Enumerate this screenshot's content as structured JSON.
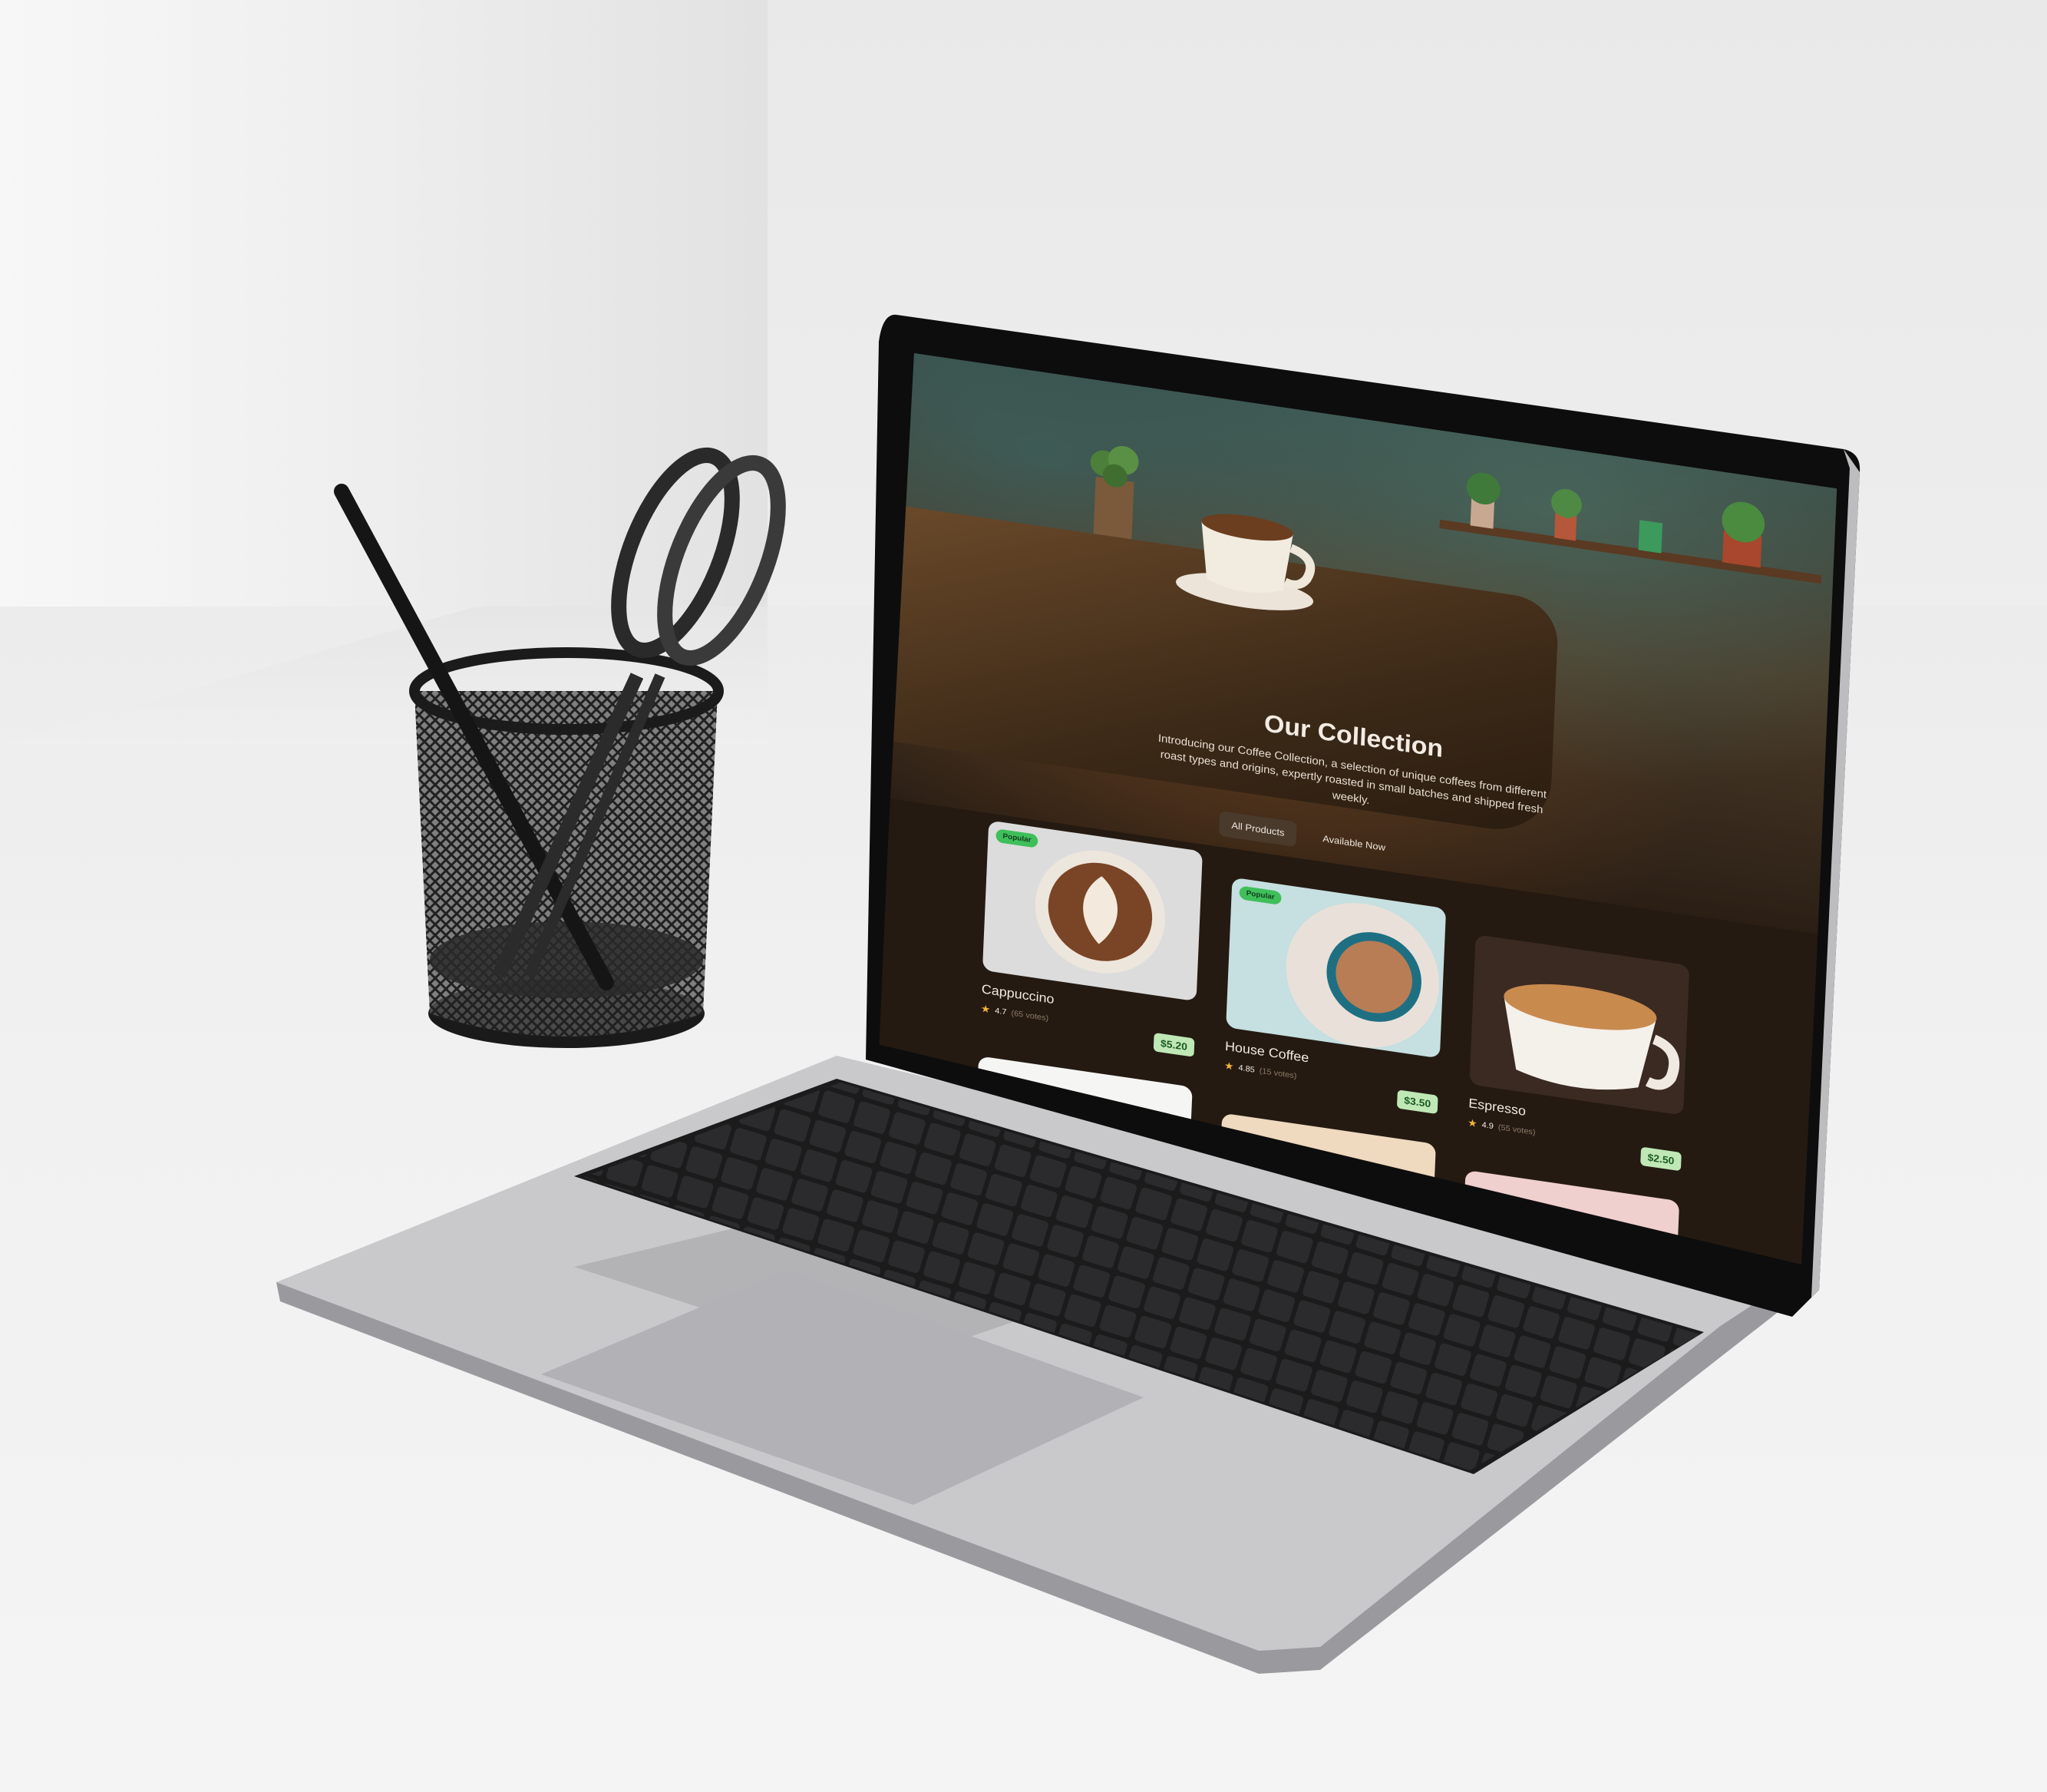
{
  "collection": {
    "title": "Our Collection",
    "description": "Introducing our Coffee Collection, a selection of unique coffees from different roast types and origins, expertly roasted in small batches and shipped fresh weekly."
  },
  "filters": {
    "all": "All Products",
    "available": "Available Now"
  },
  "products": [
    {
      "badge": "Popular",
      "name": "Cappuccino",
      "rating": "4.7",
      "votes": "(65 votes)",
      "price": "$5.20"
    },
    {
      "badge": "Popular",
      "name": "House Coffee",
      "rating": "4.85",
      "votes": "(15 votes)",
      "price": "$3.50"
    },
    {
      "name": "Espresso",
      "rating": "4.9",
      "votes": "(55 votes)",
      "price": "$2.50"
    }
  ],
  "colors": {
    "page_background": "#241a12",
    "badge": "#3fbf5a",
    "price_tag": "#bfe8b6",
    "star": "#f3b23a"
  },
  "icons": [
    "star-icon"
  ]
}
